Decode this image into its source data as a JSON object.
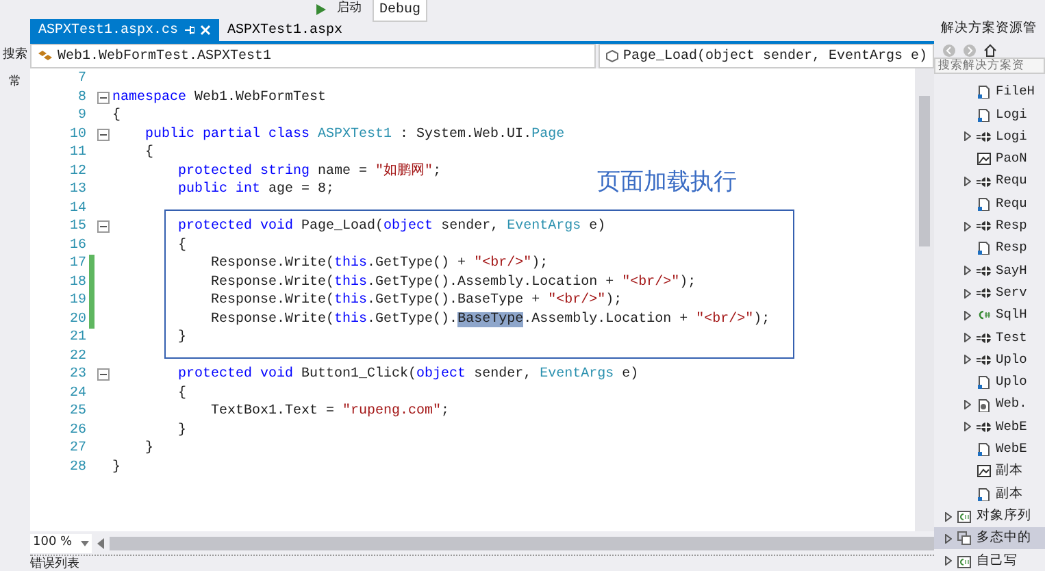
{
  "toolbar": {
    "start_label": "启动",
    "config": "Debug"
  },
  "left_strip": {
    "labels": [
      "搜索",
      "常"
    ]
  },
  "tabs": [
    {
      "label": "ASPXTest1.aspx.cs",
      "selected": true
    },
    {
      "label": "ASPXTest1.aspx",
      "selected": false
    }
  ],
  "nav_bar": {
    "class_dropdown": "Web1.WebFormTest.ASPXTest1",
    "member_dropdown": "Page_Load(object sender, EventArgs e)"
  },
  "editor": {
    "lines": [
      {
        "number": "7",
        "fold": false,
        "changed": false
      },
      {
        "number": "8",
        "fold": true,
        "changed": false,
        "tokens": [
          {
            "text": "namespace",
            "kind": "keyword"
          },
          {
            "text": " Web1.WebFormTest",
            "kind": "plain"
          }
        ]
      },
      {
        "number": "9",
        "fold": false,
        "changed": false,
        "tokens": [
          {
            "text": "{",
            "kind": "plain"
          }
        ]
      },
      {
        "number": "10",
        "fold": true,
        "changed": false,
        "tokens": [
          {
            "text": "    public partial class ",
            "kind": "keyword"
          },
          {
            "text": "ASPXTest1",
            "kind": "type"
          },
          {
            "text": " : System.Web.UI.",
            "kind": "plain"
          },
          {
            "text": "Page",
            "kind": "type"
          }
        ]
      },
      {
        "number": "11",
        "fold": false,
        "changed": false,
        "tokens": [
          {
            "text": "    {",
            "kind": "plain"
          }
        ]
      },
      {
        "number": "12",
        "fold": false,
        "changed": false,
        "tokens": [
          {
            "text": "        protected string",
            "kind": "keyword"
          },
          {
            "text": " name = ",
            "kind": "plain"
          },
          {
            "text": "\"如鹏网\"",
            "kind": "string"
          },
          {
            "text": ";",
            "kind": "plain"
          }
        ]
      },
      {
        "number": "13",
        "fold": false,
        "changed": false,
        "tokens": [
          {
            "text": "        public int",
            "kind": "keyword"
          },
          {
            "text": " age = 8;",
            "kind": "plain"
          }
        ]
      },
      {
        "number": "14",
        "fold": false,
        "changed": false
      },
      {
        "number": "15",
        "fold": true,
        "changed": false,
        "tokens": [
          {
            "text": "        protected void",
            "kind": "keyword"
          },
          {
            "text": " Page_Load(",
            "kind": "plain"
          },
          {
            "text": "object",
            "kind": "keyword"
          },
          {
            "text": " sender, ",
            "kind": "plain"
          },
          {
            "text": "EventArgs",
            "kind": "type"
          },
          {
            "text": " e)",
            "kind": "plain"
          }
        ]
      },
      {
        "number": "16",
        "fold": false,
        "changed": false,
        "tokens": [
          {
            "text": "        {",
            "kind": "plain"
          }
        ]
      },
      {
        "number": "17",
        "fold": false,
        "changed": true,
        "tokens": [
          {
            "text": "            Response.Write(",
            "kind": "plain"
          },
          {
            "text": "this",
            "kind": "keyword"
          },
          {
            "text": ".GetType() + ",
            "kind": "plain"
          },
          {
            "text": "\"<br/>\"",
            "kind": "string"
          },
          {
            "text": ");",
            "kind": "plain"
          }
        ]
      },
      {
        "number": "18",
        "fold": false,
        "changed": true,
        "tokens": [
          {
            "text": "            Response.Write(",
            "kind": "plain"
          },
          {
            "text": "this",
            "kind": "keyword"
          },
          {
            "text": ".GetType().Assembly.Location + ",
            "kind": "plain"
          },
          {
            "text": "\"<br/>\"",
            "kind": "string"
          },
          {
            "text": ");",
            "kind": "plain"
          }
        ]
      },
      {
        "number": "19",
        "fold": false,
        "changed": true,
        "tokens": [
          {
            "text": "            Response.Write(",
            "kind": "plain"
          },
          {
            "text": "this",
            "kind": "keyword"
          },
          {
            "text": ".GetType().BaseType + ",
            "kind": "plain"
          },
          {
            "text": "\"<br/>\"",
            "kind": "string"
          },
          {
            "text": ");",
            "kind": "plain"
          }
        ]
      },
      {
        "number": "20",
        "fold": false,
        "changed": true,
        "tokens": [
          {
            "text": "            Response.Write(",
            "kind": "plain"
          },
          {
            "text": "this",
            "kind": "keyword"
          },
          {
            "text": ".GetType().",
            "kind": "plain"
          },
          {
            "text": "BaseType",
            "kind": "selection"
          },
          {
            "text": ".Assembly.Location + ",
            "kind": "plain"
          },
          {
            "text": "\"<br/>\"",
            "kind": "string"
          },
          {
            "text": ");",
            "kind": "plain"
          }
        ]
      },
      {
        "number": "21",
        "fold": false,
        "changed": false,
        "tokens": [
          {
            "text": "        }",
            "kind": "plain"
          }
        ]
      },
      {
        "number": "22",
        "fold": false,
        "changed": false
      },
      {
        "number": "23",
        "fold": true,
        "changed": false,
        "tokens": [
          {
            "text": "        protected void",
            "kind": "keyword"
          },
          {
            "text": " Button1_Click(",
            "kind": "plain"
          },
          {
            "text": "object",
            "kind": "keyword"
          },
          {
            "text": " sender, ",
            "kind": "plain"
          },
          {
            "text": "EventArgs",
            "kind": "type"
          },
          {
            "text": " e)",
            "kind": "plain"
          }
        ]
      },
      {
        "number": "24",
        "fold": false,
        "changed": false,
        "tokens": [
          {
            "text": "        {",
            "kind": "plain"
          }
        ]
      },
      {
        "number": "25",
        "fold": false,
        "changed": false,
        "tokens": [
          {
            "text": "            TextBox1.Text = ",
            "kind": "plain"
          },
          {
            "text": "\"rupeng.com\"",
            "kind": "string"
          },
          {
            "text": ";",
            "kind": "plain"
          }
        ]
      },
      {
        "number": "26",
        "fold": false,
        "changed": false,
        "tokens": [
          {
            "text": "        }",
            "kind": "plain"
          }
        ]
      },
      {
        "number": "27",
        "fold": false,
        "changed": false,
        "tokens": [
          {
            "text": "    }",
            "kind": "plain"
          }
        ]
      },
      {
        "number": "28",
        "fold": false,
        "changed": false,
        "tokens": [
          {
            "text": "}",
            "kind": "plain"
          }
        ]
      }
    ],
    "annotation": "页面加载执行",
    "zoom": "100 %"
  },
  "bottom_panel": {
    "title": "错误列表"
  },
  "solution_explorer": {
    "title": "解决方案资源管",
    "search": {
      "placeholder": "搜索解决方案资"
    },
    "folder_items": [
      {
        "label": "FileH",
        "kind": "page",
        "expandable": false,
        "selected": false
      },
      {
        "label": "Logi",
        "kind": "page",
        "expandable": false,
        "selected": false
      },
      {
        "label": "Logi",
        "kind": "web",
        "expandable": true,
        "selected": false
      },
      {
        "label": "PaoN",
        "kind": "image",
        "expandable": false,
        "selected": false
      },
      {
        "label": "Requ",
        "kind": "web",
        "expandable": true,
        "selected": false
      },
      {
        "label": "Requ",
        "kind": "page",
        "expandable": false,
        "selected": false
      },
      {
        "label": "Resp",
        "kind": "web",
        "expandable": true,
        "selected": false
      },
      {
        "label": "Resp",
        "kind": "page",
        "expandable": false,
        "selected": false
      },
      {
        "label": "SayH",
        "kind": "web",
        "expandable": true,
        "selected": false
      },
      {
        "label": "Serv",
        "kind": "web",
        "expandable": true,
        "selected": false
      },
      {
        "label": "SqlH",
        "kind": "csharp",
        "expandable": true,
        "selected": false
      },
      {
        "label": "Test",
        "kind": "web",
        "expandable": true,
        "selected": false
      },
      {
        "label": "Uplo",
        "kind": "web",
        "expandable": true,
        "selected": false
      },
      {
        "label": "Uplo",
        "kind": "page",
        "expandable": false,
        "selected": false
      },
      {
        "label": "Web.",
        "kind": "config",
        "expandable": true,
        "selected": false
      },
      {
        "label": "WebE",
        "kind": "web",
        "expandable": true,
        "selected": false
      },
      {
        "label": "WebE",
        "kind": "page",
        "expandable": false,
        "selected": false
      },
      {
        "label": "副本",
        "kind": "image",
        "expandable": false,
        "selected": false
      },
      {
        "label": "副本",
        "kind": "page",
        "expandable": false,
        "selected": false
      }
    ],
    "project_items": [
      {
        "label": "对象序列",
        "kind": "csproject",
        "expandable": true,
        "selected": false
      },
      {
        "label": "多态中的",
        "kind": "copyproject",
        "expandable": true,
        "selected": true
      },
      {
        "label": "自己写",
        "kind": "csproject",
        "expandable": true,
        "selected": false
      }
    ]
  }
}
